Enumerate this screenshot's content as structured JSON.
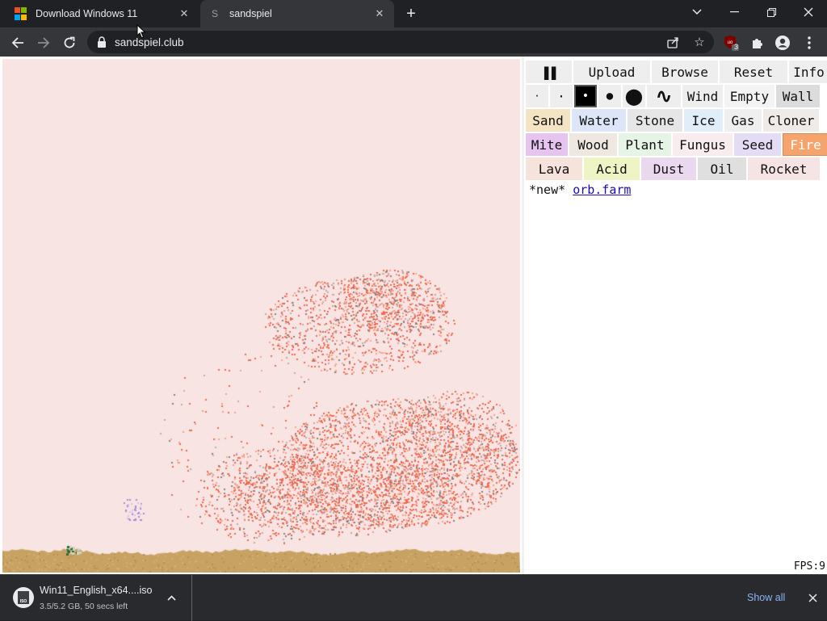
{
  "browser": {
    "tabs": [
      {
        "title": "Download Windows 11",
        "favicon": "windows-logo-icon"
      },
      {
        "title": "sandspiel",
        "favicon": "S",
        "active": true
      }
    ],
    "new_tab_label": "+",
    "url": "sandspiel.club",
    "extension_badge": "3",
    "icons": {
      "back": "arrow-left-icon",
      "forward": "arrow-right-icon",
      "reload": "reload-icon",
      "lock": "lock-icon",
      "share": "share-icon",
      "bookmark": "star-icon",
      "extensions": "puzzle-icon",
      "profile": "profile-icon",
      "menu": "kebab-icon"
    }
  },
  "toolbar_buttons": [
    "Upload",
    "Browse",
    "Reset",
    "Info"
  ],
  "pause_label": "❚❚",
  "brush_sizes": [
    {
      "glyph": "·",
      "selected": false
    },
    {
      "glyph": "·",
      "selected": false
    },
    {
      "glyph": "•",
      "selected": true
    },
    {
      "glyph": "●",
      "selected": false
    },
    {
      "glyph": "⬤",
      "selected": false
    },
    {
      "glyph": "∿",
      "selected": false
    }
  ],
  "tool_buttons": [
    "Wind",
    "Empty",
    "Wall"
  ],
  "elements": {
    "row1": [
      {
        "label": "Sand",
        "color": "#f4e4c4"
      },
      {
        "label": "Water",
        "color": "#dce6f8"
      },
      {
        "label": "Stone",
        "color": "#e6e6e6"
      },
      {
        "label": "Ice",
        "color": "#e1eef9"
      },
      {
        "label": "Gas",
        "color": "#efefef"
      },
      {
        "label": "Cloner",
        "color": "#efebe8"
      }
    ],
    "row2": [
      {
        "label": "Mite",
        "color": "#e6c4ef"
      },
      {
        "label": "Wood",
        "color": "#eee8e0"
      },
      {
        "label": "Plant",
        "color": "#e6f4e6"
      },
      {
        "label": "Fungus",
        "color": "#f9ecee"
      },
      {
        "label": "Seed",
        "color": "#e3dcf4"
      },
      {
        "label": "Fire",
        "color": "#f4a46c",
        "selected": true
      }
    ],
    "row3": [
      {
        "label": "Lava",
        "color": "#f6e3dc"
      },
      {
        "label": "Acid",
        "color": "#eef4c4"
      },
      {
        "label": "Dust",
        "color": "#ead8ee"
      },
      {
        "label": "Oil",
        "color": "#dfdfdf"
      },
      {
        "label": "Rocket",
        "color": "#f6e4e4"
      }
    ]
  },
  "new_prefix": "*new*",
  "new_link": "orb.farm",
  "fps": "FPS:9",
  "download": {
    "file": "Win11_English_x64....iso",
    "status": "3.5/5.2 GB, 50 secs left",
    "show_all": "Show all",
    "icon_label": "ISO"
  }
}
